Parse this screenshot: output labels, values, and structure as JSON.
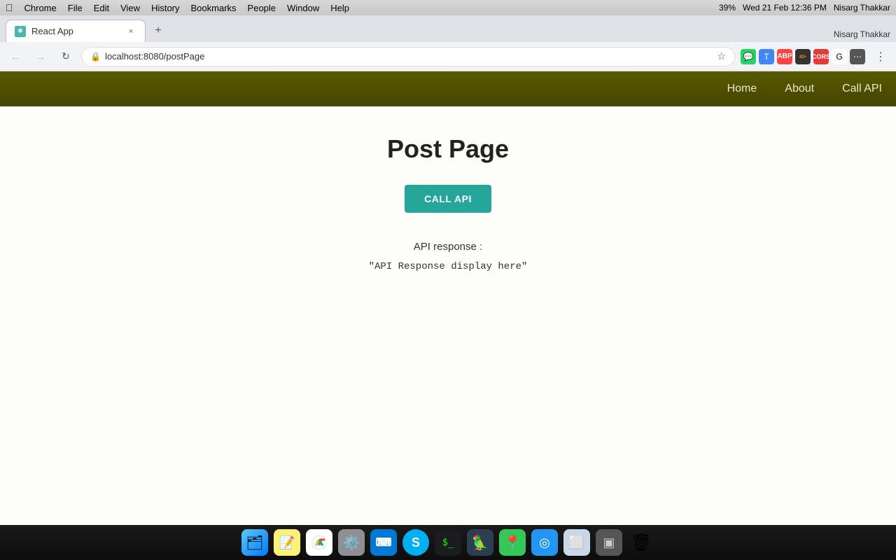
{
  "macos": {
    "menubar": {
      "apple": "&#63743;",
      "items": [
        "Chrome",
        "File",
        "Edit",
        "View",
        "History",
        "Bookmarks",
        "People",
        "Window",
        "Help"
      ],
      "right": {
        "battery": "39%",
        "datetime": "Wed 21 Feb  12:36 PM",
        "user": "Nisarg Thakkar"
      }
    }
  },
  "browser": {
    "tab": {
      "favicon": "⚛",
      "title": "React App",
      "close": "×"
    },
    "new_tab_btn": "+",
    "nav": {
      "back": "←",
      "forward": "→",
      "reload": "↻"
    },
    "address": {
      "lock_icon": "🔒",
      "url": "localhost:8080/postPage",
      "star": "☆"
    }
  },
  "app": {
    "navbar": {
      "links": [
        "Home",
        "About",
        "Call API"
      ]
    },
    "page": {
      "title": "Post Page",
      "call_api_button": "CALL API",
      "api_response_label": "API response :",
      "api_response_value": "\"API Response display here\""
    }
  },
  "dock": {
    "icons": [
      {
        "name": "finder",
        "symbol": "🗂",
        "class": "dock-finder"
      },
      {
        "name": "notes",
        "symbol": "📝",
        "class": "dock-notes"
      },
      {
        "name": "chrome",
        "symbol": "🌐",
        "class": "dock-chrome"
      },
      {
        "name": "settings",
        "symbol": "⚙️",
        "class": "dock-settings"
      },
      {
        "name": "vscode",
        "symbol": "⌨",
        "class": "dock-vscode"
      },
      {
        "name": "skype",
        "symbol": "S",
        "class": "dock-skype"
      },
      {
        "name": "terminal",
        "symbol": "$",
        "class": "dock-terminal"
      },
      {
        "name": "parrot",
        "symbol": "🦜",
        "class": "dock-parrot"
      },
      {
        "name": "maps",
        "symbol": "📍",
        "class": "dock-maps"
      },
      {
        "name": "browser2",
        "symbol": "◎",
        "class": "dock-browser"
      },
      {
        "name": "finder2",
        "symbol": "⬜",
        "class": "dock-finder2"
      },
      {
        "name": "multiwindow",
        "symbol": "▣",
        "class": "dock-multiwindow"
      },
      {
        "name": "trash",
        "symbol": "🗑",
        "class": "dock-trash"
      }
    ]
  }
}
